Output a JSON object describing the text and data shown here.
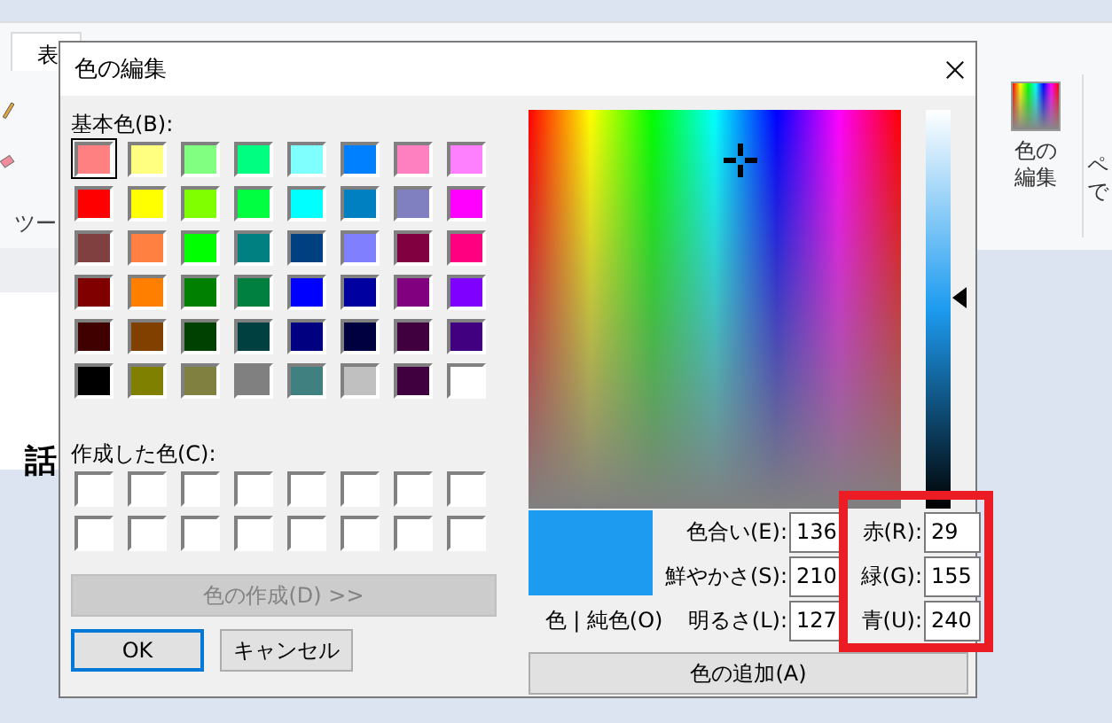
{
  "paint": {
    "tab": "表",
    "tools_label": "ツー",
    "canvas_text": "話",
    "ribbon_button": "色の編集",
    "ribbon_fragments": [
      "ペ",
      "で"
    ]
  },
  "dialog": {
    "title": "色の編集",
    "basic_label": "基本色(B):",
    "basic_colors": [
      {
        "color": "#ff8080",
        "selected": true
      },
      {
        "color": "#ffff80",
        "selected": false
      },
      {
        "color": "#80ff80",
        "selected": false
      },
      {
        "color": "#00ff80",
        "selected": false
      },
      {
        "color": "#80ffff",
        "selected": false
      },
      {
        "color": "#0080ff",
        "selected": false
      },
      {
        "color": "#ff80c0",
        "selected": false
      },
      {
        "color": "#ff80ff",
        "selected": false
      },
      {
        "color": "#ff0000",
        "selected": false
      },
      {
        "color": "#ffff00",
        "selected": false
      },
      {
        "color": "#80ff00",
        "selected": false
      },
      {
        "color": "#00ff40",
        "selected": false
      },
      {
        "color": "#00ffff",
        "selected": false
      },
      {
        "color": "#0080c0",
        "selected": false
      },
      {
        "color": "#8080c0",
        "selected": false
      },
      {
        "color": "#ff00ff",
        "selected": false
      },
      {
        "color": "#804040",
        "selected": false
      },
      {
        "color": "#ff8040",
        "selected": false
      },
      {
        "color": "#00ff00",
        "selected": false
      },
      {
        "color": "#008080",
        "selected": false
      },
      {
        "color": "#004080",
        "selected": false
      },
      {
        "color": "#8080ff",
        "selected": false
      },
      {
        "color": "#800040",
        "selected": false
      },
      {
        "color": "#ff0080",
        "selected": false
      },
      {
        "color": "#800000",
        "selected": false
      },
      {
        "color": "#ff8000",
        "selected": false
      },
      {
        "color": "#008000",
        "selected": false
      },
      {
        "color": "#008040",
        "selected": false
      },
      {
        "color": "#0000ff",
        "selected": false
      },
      {
        "color": "#0000a0",
        "selected": false
      },
      {
        "color": "#800080",
        "selected": false
      },
      {
        "color": "#8000ff",
        "selected": false
      },
      {
        "color": "#400000",
        "selected": false
      },
      {
        "color": "#804000",
        "selected": false
      },
      {
        "color": "#004000",
        "selected": false
      },
      {
        "color": "#004040",
        "selected": false
      },
      {
        "color": "#000080",
        "selected": false
      },
      {
        "color": "#000040",
        "selected": false
      },
      {
        "color": "#400040",
        "selected": false
      },
      {
        "color": "#400080",
        "selected": false
      },
      {
        "color": "#000000",
        "selected": false
      },
      {
        "color": "#808000",
        "selected": false
      },
      {
        "color": "#808040",
        "selected": false
      },
      {
        "color": "#808080",
        "selected": false
      },
      {
        "color": "#408080",
        "selected": false
      },
      {
        "color": "#c0c0c0",
        "selected": false
      },
      {
        "color": "#400040",
        "selected": false
      },
      {
        "color": "#ffffff",
        "selected": false
      }
    ],
    "custom_label": "作成した色(C):",
    "custom_colors": [
      {
        "color": "#ffffff"
      },
      {
        "color": "#ffffff"
      },
      {
        "color": "#ffffff"
      },
      {
        "color": "#ffffff"
      },
      {
        "color": "#ffffff"
      },
      {
        "color": "#ffffff"
      },
      {
        "color": "#ffffff"
      },
      {
        "color": "#ffffff"
      },
      {
        "color": "#ffffff"
      },
      {
        "color": "#ffffff"
      },
      {
        "color": "#ffffff"
      },
      {
        "color": "#ffffff"
      },
      {
        "color": "#ffffff"
      },
      {
        "color": "#ffffff"
      },
      {
        "color": "#ffffff"
      },
      {
        "color": "#ffffff"
      }
    ],
    "define_button": {
      "label": "色の作成(D) >>",
      "disabled": true
    },
    "ok_button": "OK",
    "cancel_button": "キャンセル",
    "preview": {
      "color": "#1d9bf0",
      "label": "色 | 純色(O)"
    },
    "hsl": [
      {
        "label": "色合い(E):",
        "value": "136"
      },
      {
        "label": "鮮やかさ(S):",
        "value": "210"
      },
      {
        "label": "明るさ(L):",
        "value": "127"
      }
    ],
    "rgb": [
      {
        "label": "赤(R):",
        "value": "29"
      },
      {
        "label": "緑(G):",
        "value": "155"
      },
      {
        "label": "青(U):",
        "value": "240"
      }
    ],
    "rgb_highlighted": true,
    "add_button": "色の追加(A)"
  }
}
